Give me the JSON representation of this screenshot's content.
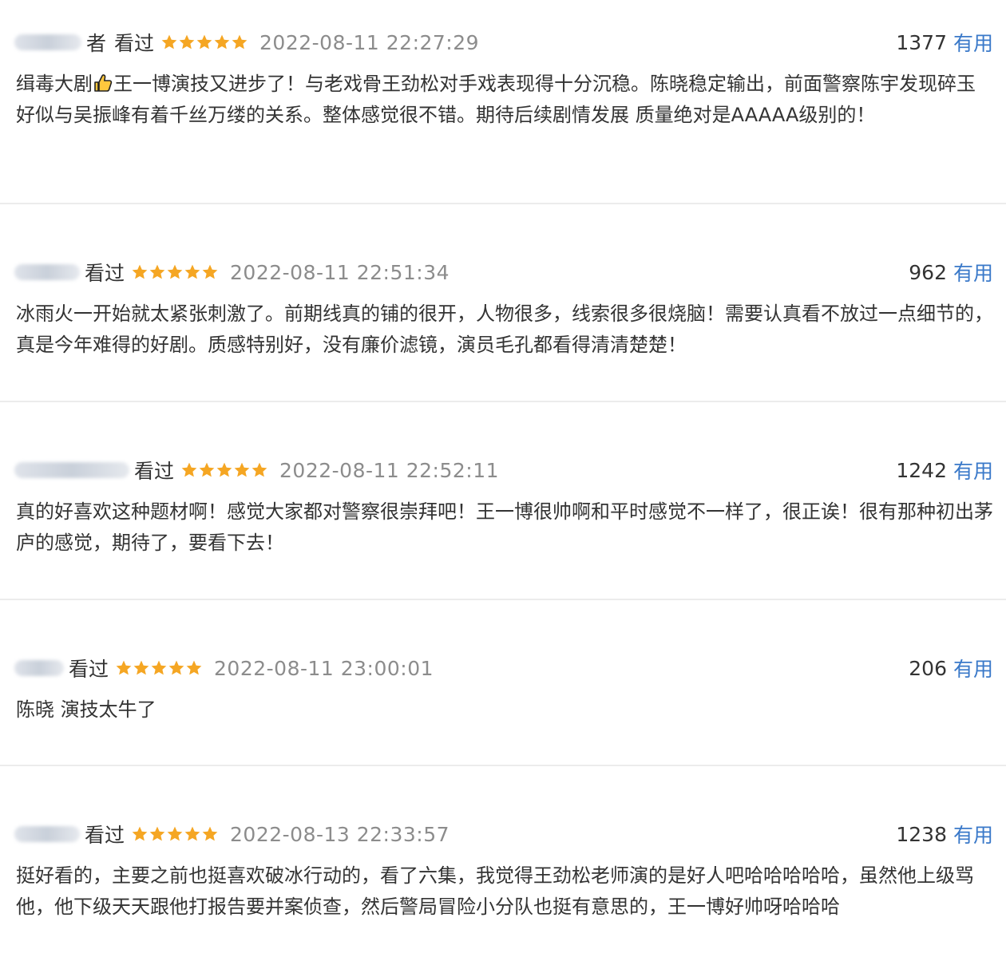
{
  "theme": {
    "star_color": "#f5a623",
    "useful_color": "#3a79c9",
    "time_color": "#8c8c8c",
    "divider_color": "#ececec"
  },
  "reviews": [
    {
      "username_visible_tail": "者",
      "seen": "看过",
      "stars": 5,
      "time": "2022-08-11 22:27:29",
      "count": "1377",
      "useful": "有用",
      "text_before_icon": "缉毒大剧",
      "inline_icon": "thumbs-up-icon",
      "text_after_icon": "王一博演技又进步了！与老戏骨王劲松对手戏表现得十分沉稳。陈晓稳定输出，前面警察陈宇发现碎玉好似与吴振峰有着千丝万缕的关系。整体感觉很不错。期待后续剧情发展 质量绝对是AAAAA级别的！"
    },
    {
      "username_visible_tail": "",
      "seen": "看过",
      "stars": 5,
      "time": "2022-08-11 22:51:34",
      "count": "962",
      "useful": "有用",
      "text": "冰雨火一开始就太紧张刺激了。前期线真的铺的很开，人物很多，线索很多很烧脑！需要认真看不放过一点细节的，真是今年难得的好剧。质感特别好，没有廉价滤镜，演员毛孔都看得清清楚楚！"
    },
    {
      "username_visible_tail": "",
      "seen": "看过",
      "stars": 5,
      "time": "2022-08-11 22:52:11",
      "count": "1242",
      "useful": "有用",
      "text": "真的好喜欢这种题材啊！感觉大家都对警察很崇拜吧！王一博很帅啊和平时感觉不一样了，很正诶！很有那种初出茅庐的感觉，期待了，要看下去！"
    },
    {
      "username_visible_tail": "",
      "seen": "看过",
      "stars": 5,
      "time": "2022-08-11 23:00:01",
      "count": "206",
      "useful": "有用",
      "text": "陈晓 演技太牛了"
    },
    {
      "username_visible_tail": "",
      "seen": "看过",
      "stars": 5,
      "time": "2022-08-13 22:33:57",
      "count": "1238",
      "useful": "有用",
      "text": "挺好看的，主要之前也挺喜欢破冰行动的，看了六集，我觉得王劲松老师演的是好人吧哈哈哈哈哈，虽然他上级骂他，他下级天天跟他打报告要并案侦查，然后警局冒险小分队也挺有意思的，王一博好帅呀哈哈哈"
    }
  ]
}
